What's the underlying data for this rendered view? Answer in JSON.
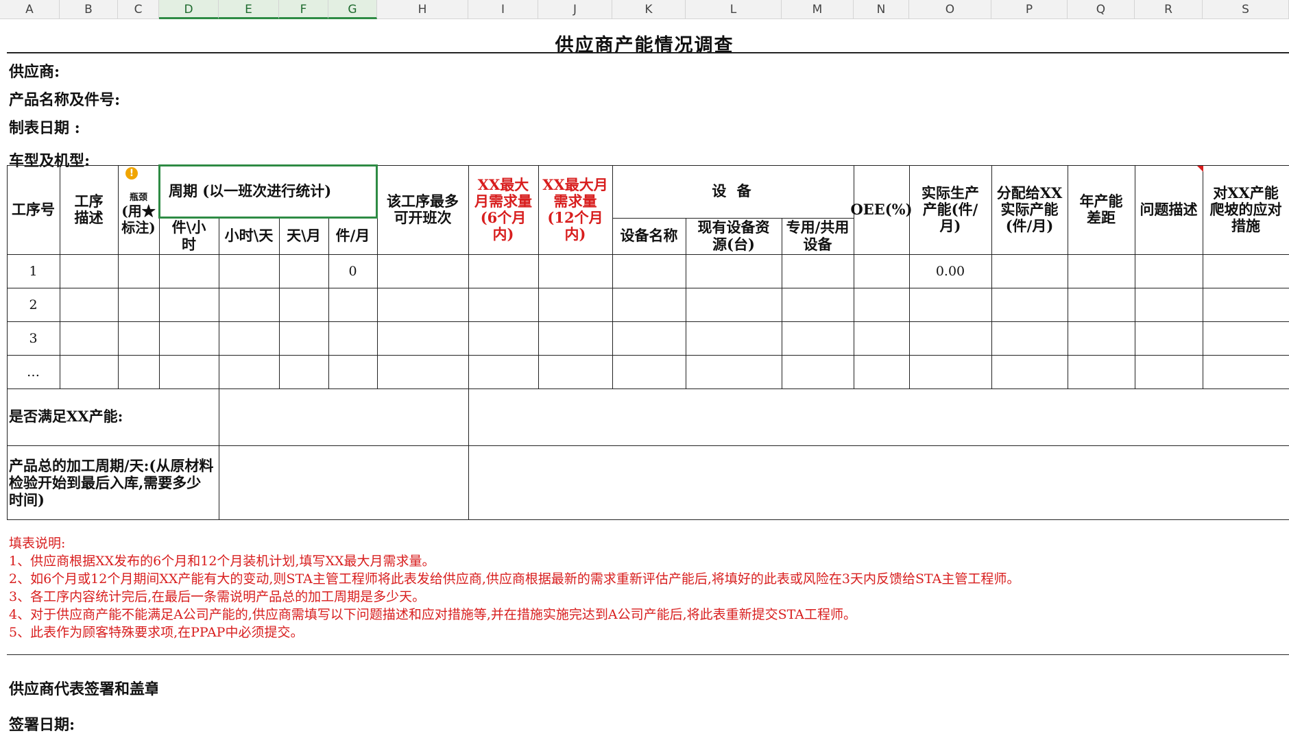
{
  "columns": [
    "A",
    "B",
    "C",
    "D",
    "E",
    "F",
    "G",
    "H",
    "I",
    "J",
    "K",
    "L",
    "M",
    "N",
    "O",
    "P",
    "Q",
    "R",
    "S"
  ],
  "selected_columns": [
    "D",
    "E",
    "F",
    "G"
  ],
  "title": "供应商产能情况调查",
  "info": {
    "supplier": "供应商:",
    "product": "产品名称及件号:",
    "date": "制表日期 :",
    "model": "车型及机型:"
  },
  "headers": {
    "process_no": "工序号",
    "process_desc": "工序描述",
    "key_mark": "(用★标注)",
    "key_mark_top": "瓶颈",
    "cycle": "周期 (以一班次进行统计)",
    "pcs_hour": "件\\小时",
    "hour_day": "小时\\天",
    "day_month": "天\\月",
    "pcs_month": "件/月",
    "max_shifts": "该工序最多可开班次",
    "max_demand_6": "XX最大月需求量(6个月内)",
    "max_demand_12": "XX最大月需求量(12个月内)",
    "equipment": "设  备",
    "equip_name": "设备名称",
    "equip_count": "现有设备资源(台)",
    "equip_shared": "专用/共用设备",
    "oee": "OEE(%)",
    "actual_capacity": "实际生产产能(件/月)",
    "allocated_capacity": "分配给XX实际产能(件/月)",
    "annual_gap": "年产能差距",
    "issue_desc": "问题描述",
    "ramp_measures": "对XX产能爬坡的应对措施"
  },
  "rows": [
    {
      "no": "1",
      "pcs_month": "0",
      "actual": "0.00"
    },
    {
      "no": "2",
      "pcs_month": "",
      "actual": ""
    },
    {
      "no": "3",
      "pcs_month": "",
      "actual": ""
    },
    {
      "no": "…",
      "pcs_month": "",
      "actual": ""
    }
  ],
  "meets_capacity_label": "是否满足XX产能:",
  "total_cycle_label": "产品总的加工周期/天:(从原材料检验开始到最后入库,需要多少时间)",
  "notes": [
    "填表说明:",
    "1、供应商根据XX发布的6个月和12个月装机计划,填写XX最大月需求量。",
    "2、如6个月或12个月期间XX产能有大的变动,则STA主管工程师将此表发给供应商,供应商根据最新的需求重新评估产能后,将填好的此表或风险在3天内反馈给STA主管工程师。",
    "3、各工序内容统计完后,在最后一条需说明产品总的加工周期是多少天。",
    "4、对于供应商产能不能满足A公司产能的,供应商需填写以下问题描述和应对措施等,并在措施实施完达到A公司产能后,将此表重新提交STA工程师。",
    "5、此表作为顾客特殊要求项,在PPAP中必须提交。"
  ],
  "signature_label": "供应商代表签署和盖章",
  "sign_date_label": "签署日期:",
  "colors": {
    "red": "#d81e1e",
    "select_green": "#2e8b44"
  }
}
